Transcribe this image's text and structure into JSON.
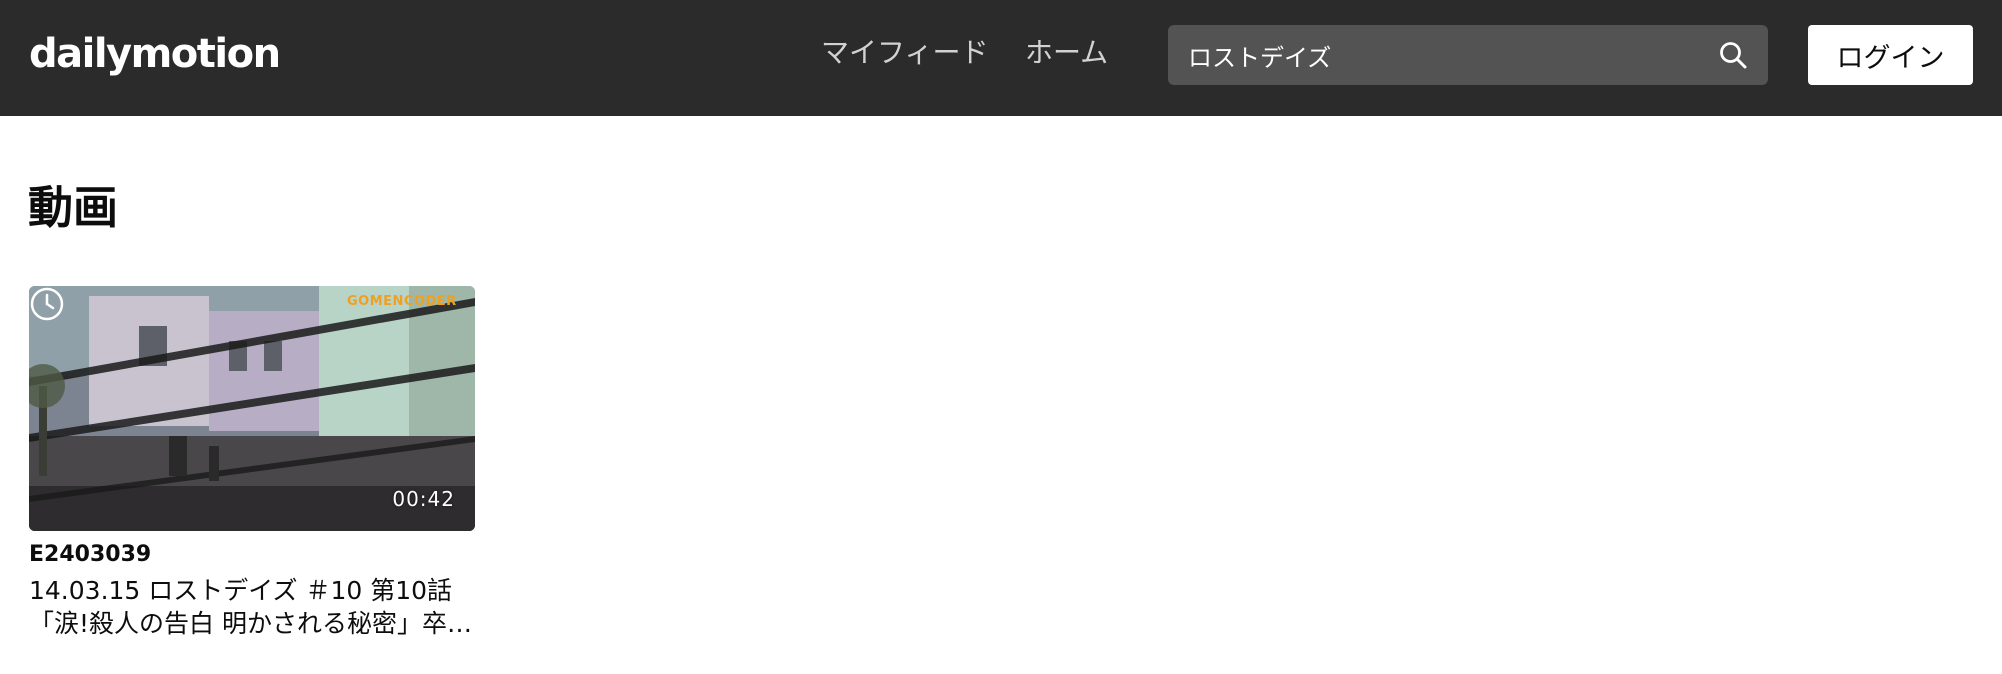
{
  "header": {
    "logo_text": "dailymotion",
    "nav": [
      {
        "label": "マイフィード"
      },
      {
        "label": "ホーム"
      }
    ],
    "search": {
      "value": "ロストデイズ",
      "icon": "search-icon"
    },
    "login_label": "ログイン"
  },
  "main": {
    "section_title": "動画",
    "videos": [
      {
        "duration": "00:42",
        "watermark": "GOMENCODER",
        "channel": "E2403039",
        "title_line1": "14.03.15 ロストデイズ ＃10 第10話",
        "title_line2": "「涙!殺人の告白 明かされる秘密」卒…",
        "icon": "clock-icon"
      }
    ]
  },
  "colors": {
    "header_bg": "#2b2b2b",
    "search_bg": "#535353",
    "page_bg": "#ffffff",
    "text": "#0d0d0d"
  }
}
